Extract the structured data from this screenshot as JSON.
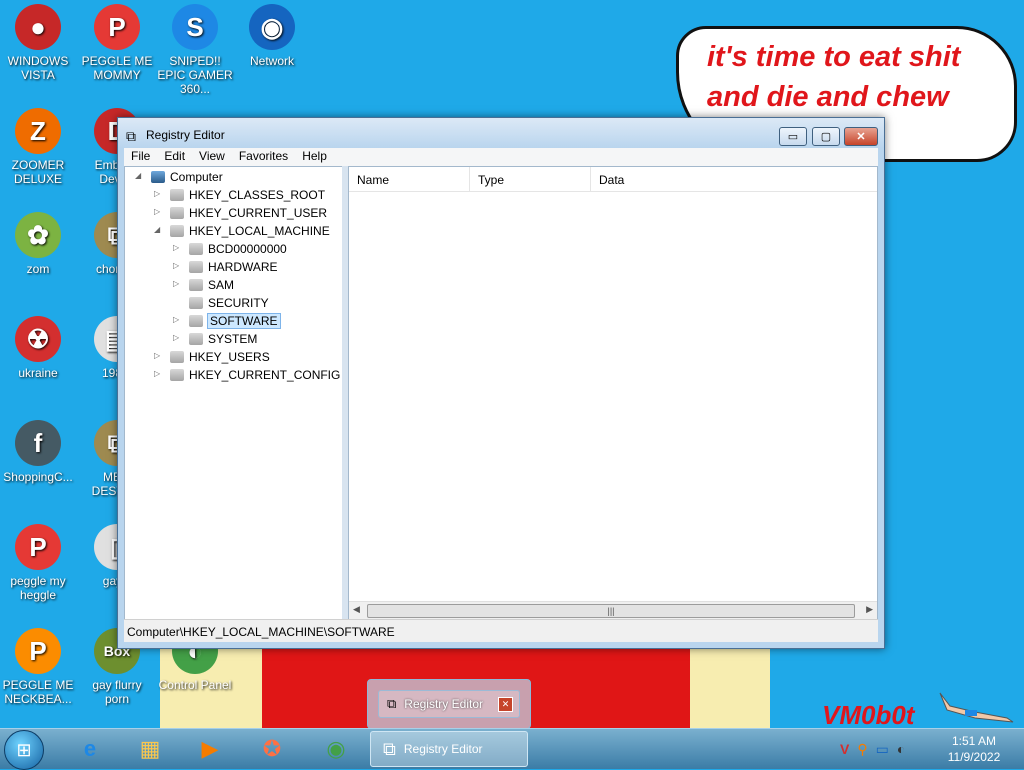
{
  "desktop": {
    "bubble_text": "it's time to eat shit and die and chew",
    "watermark": "VM0b0t",
    "icons": [
      {
        "label": "WINDOWS VISTA",
        "glyph": "●",
        "color": "#c62828"
      },
      {
        "label": "PEGGLE ME MOMMY",
        "glyph": "P",
        "color": "#e53935"
      },
      {
        "label": "SNIPED!! EPIC GAMER 360...",
        "glyph": "S",
        "color": "#1e88e5"
      },
      {
        "label": "Network",
        "glyph": "◉",
        "color": "#1565c0"
      },
      {
        "label": "ZOOMER DELUXE",
        "glyph": "Z",
        "color": "#ef6c00"
      },
      {
        "label": "Embar... Dev-...",
        "glyph": "D",
        "color": "#c62828"
      },
      {
        "label": "zom",
        "glyph": "✿",
        "color": "#7cb342"
      },
      {
        "label": "chomi...",
        "glyph": "⧉",
        "color": "#9e8a50"
      },
      {
        "label": "ukraine",
        "glyph": "☢",
        "color": "#d32f2f"
      },
      {
        "label": "198...",
        "glyph": "▤",
        "color": "#e0e0e0"
      },
      {
        "label": "ShoppingC...",
        "glyph": "f",
        "color": "#455a64"
      },
      {
        "label": "ME... DESTR...",
        "glyph": "⧉",
        "color": "#9e8a50"
      },
      {
        "label": "peggle my heggle",
        "glyph": "P",
        "color": "#e53935"
      },
      {
        "label": "gay...",
        "glyph": "▯",
        "color": "#e0e0e0"
      },
      {
        "label": "PEGGLE ME NECKBEA...",
        "glyph": "P",
        "color": "#fb8c00"
      },
      {
        "label": "gay flurry porn",
        "glyph": "Box",
        "color": "#6d8f2f"
      },
      {
        "label": "Control Panel",
        "glyph": "◐",
        "color": "#43a047"
      }
    ]
  },
  "window": {
    "title": "Registry Editor",
    "controls": {
      "minimize": "▭",
      "maximize": "▢",
      "close": "✕"
    },
    "menu": [
      "File",
      "Edit",
      "View",
      "Favorites",
      "Help"
    ],
    "tree": {
      "root": "Computer",
      "nodes": [
        "HKEY_CLASSES_ROOT",
        "HKEY_CURRENT_USER",
        "HKEY_LOCAL_MACHINE",
        "BCD00000000",
        "HARDWARE",
        "SAM",
        "SECURITY",
        "SOFTWARE",
        "SYSTEM",
        "HKEY_USERS",
        "HKEY_CURRENT_CONFIG"
      ]
    },
    "columns": [
      "Name",
      "Type",
      "Data"
    ],
    "scroll_grip": "|||",
    "status_path": "Computer\\HKEY_LOCAL_MACHINE\\SOFTWARE"
  },
  "thumbnail": {
    "title": "Registry Editor",
    "close": "✕"
  },
  "taskbar": {
    "start_glyph": "⊞",
    "pinned": [
      {
        "name": "ie",
        "glyph": "e",
        "color": "#1e88e5"
      },
      {
        "name": "explorer",
        "glyph": "▦",
        "color": "#f9c74f"
      },
      {
        "name": "media",
        "glyph": "▶",
        "color": "#f57c00"
      },
      {
        "name": "uc",
        "glyph": "✪",
        "color": "#ff7043"
      },
      {
        "name": "chrome",
        "glyph": "◉",
        "color": "#43a047"
      }
    ],
    "active_label": "Registry Editor",
    "tray": [
      "V",
      "⚲",
      "▭",
      "◐"
    ],
    "clock_time": "1:51 AM",
    "clock_date": "11/9/2022"
  }
}
